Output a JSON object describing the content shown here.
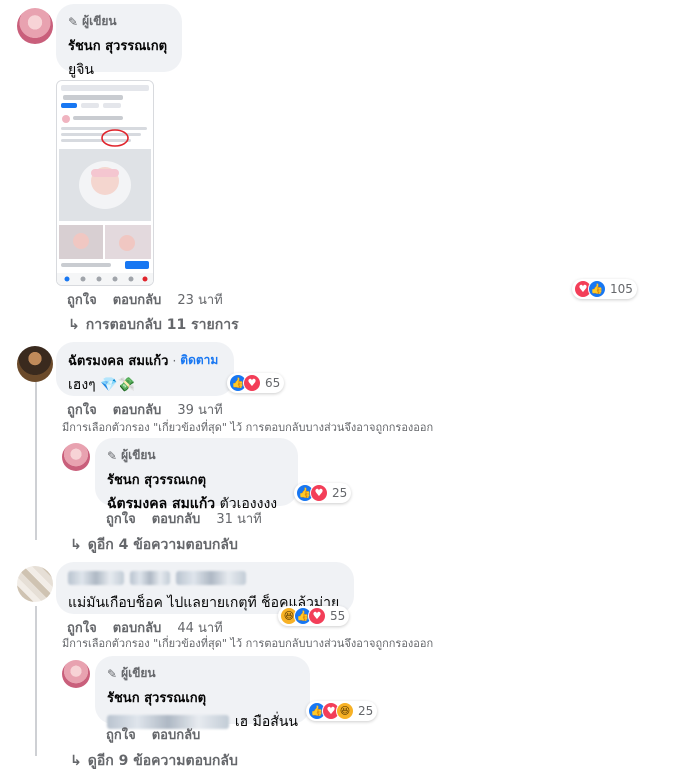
{
  "comment1": {
    "author_tag": "ผู้เขียน",
    "name": "รัชนก สุวรรณเกตุ",
    "text": "ยูจิน",
    "like": "ถูกใจ",
    "reply": "ตอบกลับ",
    "time": "23 นาที",
    "reaction_count": "105",
    "replies_link": "การตอบกลับ 11 รายการ"
  },
  "comment2": {
    "name": "ฉัตรมงคล สมแก้ว",
    "follow": "ติดตาม",
    "text": "เฮงๆ",
    "emoji": "💎💸",
    "like": "ถูกใจ",
    "reply": "ตอบกลับ",
    "time": "39 นาที",
    "reaction_count": "65",
    "filter_note": "มีการเลือกตัวกรอง \"เกี่ยวข้องที่สุด\" ไว้ การตอบกลับบางส่วนจึงอาจถูกกรองออก"
  },
  "reply2": {
    "author_tag": "ผู้เขียน",
    "name": "รัชนก สุวรรณเกตุ",
    "mention": "ฉัตรมงคล สมแก้ว",
    "text": "ตัวเองงงง",
    "like": "ถูกใจ",
    "reply": "ตอบกลับ",
    "time": "31 นาที",
    "reaction_count": "25",
    "more_replies": "ดูอีก 4 ข้อความตอบกลับ"
  },
  "comment3": {
    "text": "แม่มันเกือบช็อค ไปแลยายเกตุที ช็อคแล้วม่าย",
    "like": "ถูกใจ",
    "reply": "ตอบกลับ",
    "time": "44 นาที",
    "reaction_count": "55",
    "filter_note": "มีการเลือกตัวกรอง \"เกี่ยวข้องที่สุด\" ไว้ การตอบกลับบางส่วนจึงอาจถูกกรองออก"
  },
  "reply3": {
    "author_tag": "ผู้เขียน",
    "name": "รัชนก สุวรรณเกตุ",
    "text": "เฮ มือสั่นน",
    "like": "ถูกใจ",
    "reply": "ตอบกลับ",
    "time": "",
    "reaction_count": "25",
    "more_replies": "ดูอีก 9 ข้อความตอบกลับ"
  },
  "icons": {
    "pencil": "pencil-icon",
    "reply_arrow": "reply-arrow-icon",
    "like": "like-reaction-icon",
    "love": "love-reaction-icon",
    "haha": "haha-reaction-icon"
  },
  "colors": {
    "link_blue": "#1877f2",
    "bubble_bg": "#f0f2f5",
    "secondary_text": "#65676b",
    "like_blue": "#1877f2",
    "love_red": "#f33e58",
    "haha_yellow": "#f7b125"
  }
}
